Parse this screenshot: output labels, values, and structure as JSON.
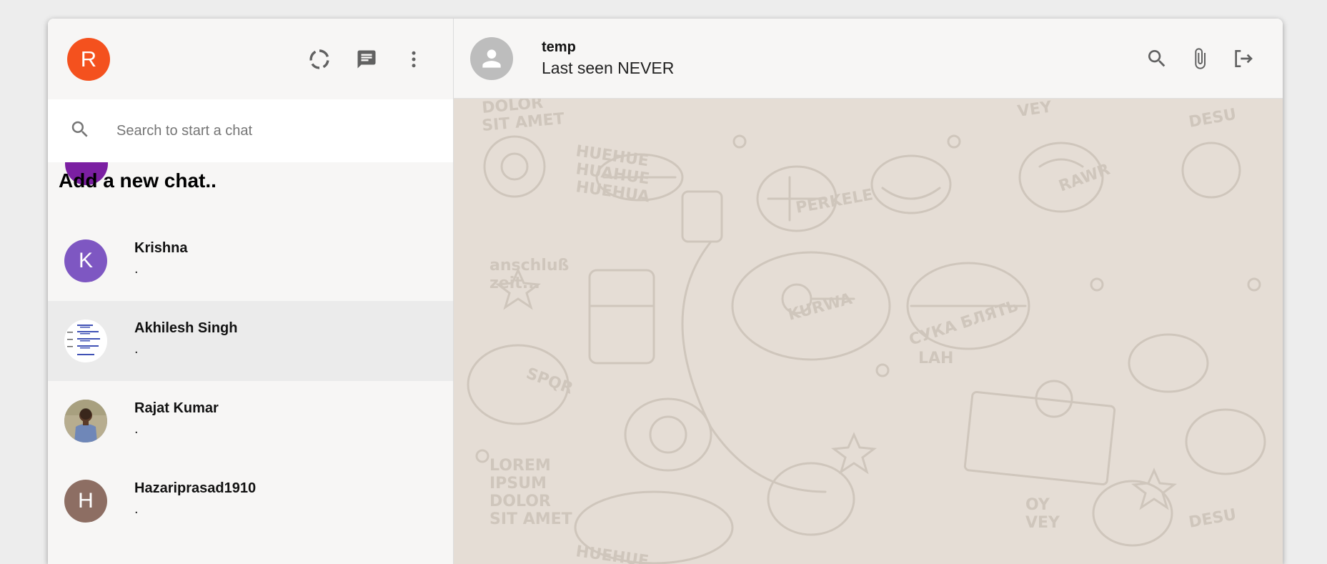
{
  "user": {
    "avatar_letter": "R",
    "avatar_color": "#f4511e"
  },
  "sidebar": {
    "icons": [
      "status-icon",
      "chat-icon",
      "more-vertical-icon"
    ],
    "search_placeholder": "Search to start a chat",
    "add_new_label": "Add a new chat..",
    "chats": [
      {
        "name": "Krishna",
        "last_message": ".",
        "avatar_letter": "K",
        "avatar_color": "#7e57c2"
      },
      {
        "name": "Akhilesh Singh",
        "last_message": ".",
        "avatar_letter": "",
        "avatar_color": "#ffffff"
      },
      {
        "name": "Rajat Kumar",
        "last_message": ".",
        "avatar_letter": "",
        "avatar_color": "#8a9bb0"
      },
      {
        "name": "Hazariprasad1910",
        "last_message": ".",
        "avatar_letter": "H",
        "avatar_color": "#8d6e63"
      }
    ]
  },
  "main": {
    "chat_name": "temp",
    "status": "Last seen NEVER",
    "icons": [
      "search-icon",
      "attach-icon",
      "logout-icon"
    ]
  },
  "colors": {
    "chat_background": "#e5ddd5",
    "sidebar_background": "#f7f6f5"
  },
  "wallpaper_text": [
    "DOLOR",
    "SIT AMET",
    "HUEHUE",
    "HUAHUE",
    "HUEHUA",
    "PERKELE",
    "RAWR",
    "DESU",
    "VEY",
    "anschluß",
    "zeit...",
    "KURWA",
    "СУКА БЛЯТЬ",
    "LAH",
    "SPQR",
    "LOREM",
    "IPSUM",
    "DOLOR",
    "SIT AMET",
    "OY",
    "VEY",
    "DESU",
    "HUEHUE"
  ]
}
